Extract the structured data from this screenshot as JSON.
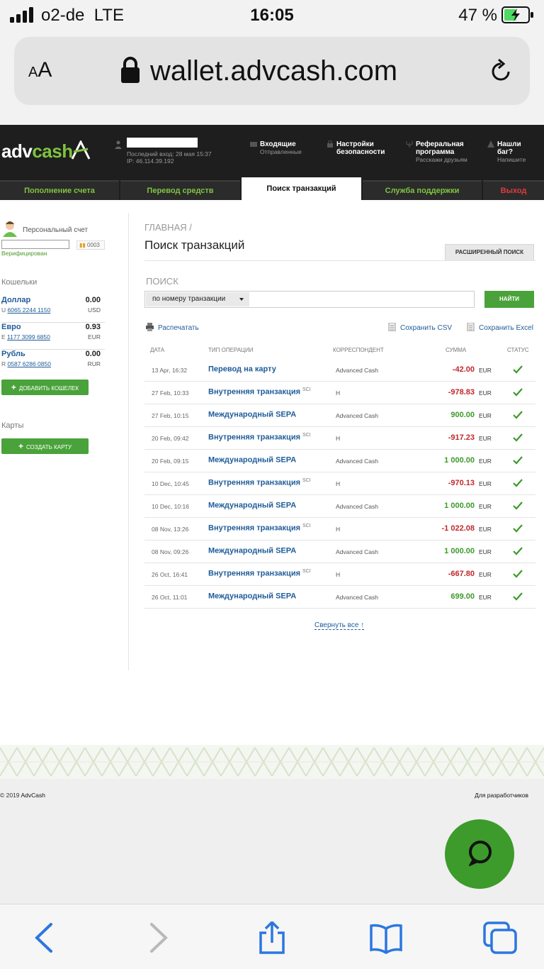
{
  "status_bar": {
    "carrier": "o2-de",
    "network": "LTE",
    "time": "16:05",
    "battery_percent": "47 %"
  },
  "browser": {
    "text_size_label": "AA",
    "url": "wallet.advcash.com"
  },
  "header": {
    "logo_adv": "adv",
    "logo_cash": "cash",
    "last_login": "Последний вход: 28 мая 15:37",
    "ip": "IP: 46.114.39.192",
    "nav": [
      {
        "title": "Входящие",
        "subtitle": "Отправленные"
      },
      {
        "title": "Настройки безопасности",
        "subtitle": ""
      },
      {
        "title": "Реферальная программа",
        "subtitle": "Расскажи друзьям"
      },
      {
        "title": "Нашли баг?",
        "subtitle": "Напишите"
      }
    ]
  },
  "tabs": [
    {
      "label": "Пополнение счета"
    },
    {
      "label": "Перевод средств"
    },
    {
      "label": "Поиск транзакций"
    },
    {
      "label": "Служба поддержки"
    },
    {
      "label": "Выход"
    }
  ],
  "sidebar": {
    "account_label": "Персональный счет",
    "account_id": "0003",
    "verified": "Верифицирован",
    "wallets_title": "Кошельки",
    "wallets": [
      {
        "name": "Доллар",
        "amount": "0.00",
        "prefix": "U",
        "account": "6065 2244 1150",
        "currency": "USD"
      },
      {
        "name": "Евро",
        "amount": "0.93",
        "prefix": "E",
        "account": "1177 3099 6850",
        "currency": "EUR"
      },
      {
        "name": "Рубль",
        "amount": "0.00",
        "prefix": "R",
        "account": "0587 6286 0850",
        "currency": "RUR"
      }
    ],
    "add_wallet": "ДОБАВИТЬ КОШЕЛЕК",
    "cards_title": "Карты",
    "create_card": "СОЗДАТЬ КАРТУ"
  },
  "main": {
    "breadcrumb": "ГЛАВНАЯ /",
    "title": "Поиск транзакций",
    "advanced_search": "РАСШИРЕННЫЙ ПОИСК",
    "search_label": "ПОИСК",
    "search_mode": "по номеру транзакции",
    "find_button": "НАЙТИ",
    "print": "Распечатать",
    "save_csv": "Сохранить CSV",
    "save_excel": "Сохранить Excel",
    "columns": [
      "ДАТА",
      "ТИП ОПЕРАЦИИ",
      "КОРРЕСПОНДЕНТ",
      "СУММА",
      "СТАТУС"
    ],
    "transactions": [
      {
        "date": "13 Apr, 16:32",
        "type": "Перевод на карту",
        "sci": "",
        "correspondent": "Advanced Cash",
        "amount": "-42.00",
        "currency": "EUR",
        "sign": "neg"
      },
      {
        "date": "27 Feb, 10:33",
        "type": "Внутренняя транзакция",
        "sci": "SCI",
        "correspondent": "H",
        "amount": "-978.83",
        "currency": "EUR",
        "sign": "neg"
      },
      {
        "date": "27 Feb, 10:15",
        "type": "Международный SEPA",
        "sci": "",
        "correspondent": "Advanced Cash",
        "amount": "900.00",
        "currency": "EUR",
        "sign": "pos"
      },
      {
        "date": "20 Feb, 09:42",
        "type": "Внутренняя транзакция",
        "sci": "SCI",
        "correspondent": "H",
        "amount": "-917.23",
        "currency": "EUR",
        "sign": "neg"
      },
      {
        "date": "20 Feb, 09:15",
        "type": "Международный SEPA",
        "sci": "",
        "correspondent": "Advanced Cash",
        "amount": "1 000.00",
        "currency": "EUR",
        "sign": "pos"
      },
      {
        "date": "10 Dec, 10:45",
        "type": "Внутренняя транзакция",
        "sci": "SCI",
        "correspondent": "H",
        "amount": "-970.13",
        "currency": "EUR",
        "sign": "neg"
      },
      {
        "date": "10 Dec, 10:16",
        "type": "Международный SEPA",
        "sci": "",
        "correspondent": "Advanced Cash",
        "amount": "1 000.00",
        "currency": "EUR",
        "sign": "pos"
      },
      {
        "date": "08 Nov, 13:26",
        "type": "Внутренняя транзакция",
        "sci": "SCI",
        "correspondent": "H",
        "amount": "-1 022.08",
        "currency": "EUR",
        "sign": "neg"
      },
      {
        "date": "08 Nov, 09:26",
        "type": "Международный SEPA",
        "sci": "",
        "correspondent": "Advanced Cash",
        "amount": "1 000.00",
        "currency": "EUR",
        "sign": "pos"
      },
      {
        "date": "26 Oct, 16:41",
        "type": "Внутренняя транзакция",
        "sci": "SCI",
        "correspondent": "H",
        "amount": "-667.80",
        "currency": "EUR",
        "sign": "neg"
      },
      {
        "date": "26 Oct, 11:01",
        "type": "Международный SEPA",
        "sci": "",
        "correspondent": "Advanced Cash",
        "amount": "699.00",
        "currency": "EUR",
        "sign": "pos"
      }
    ],
    "collapse_all": "Свернуть все ↑"
  },
  "footer": {
    "copyright": "© 2019",
    "brand": "AdvCash",
    "developers": "Для разработчиков"
  },
  "colors": {
    "brand_green": "#4aa23a",
    "header_dark": "#1e1e1e",
    "link_blue": "#1f5c99",
    "negative": "#c0282d",
    "positive": "#3d9a2a"
  }
}
